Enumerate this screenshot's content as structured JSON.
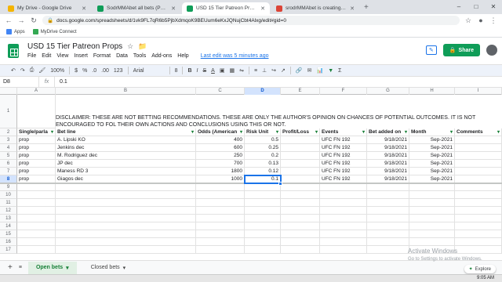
{
  "browser": {
    "tabs": [
      {
        "label": "My Drive - Google Drive",
        "color": "#f4b400",
        "active": false
      },
      {
        "label": "SodrMMAbet all bets (Patreon)",
        "color": "#0f9d58",
        "active": false
      },
      {
        "label": "USD 15 Tier Patreon Props - Goo",
        "color": "#0f9d58",
        "active": true
      },
      {
        "label": "srodrMMAbet is creating Statisti",
        "color": "#db4437",
        "active": false
      }
    ],
    "url": "docs.google.com/spreadsheets/d/1vk9FL7qR6b5PjbXdmqoK9BEUum6eKxJQNujCbt4Alxg/edit#gid=0",
    "bookmarks": [
      {
        "label": "Apps",
        "color": "#4285f4"
      },
      {
        "label": "MyDrive Connect",
        "color": "#4285f4"
      }
    ]
  },
  "doc": {
    "title": "USD 15 Tier Patreon Props",
    "menus": [
      "File",
      "Edit",
      "View",
      "Insert",
      "Format",
      "Data",
      "Tools",
      "Add-ons",
      "Help"
    ],
    "last_edit": "Last edit was 5 minutes ago",
    "share_label": "Share"
  },
  "toolbar": {
    "zoom": "100%",
    "currency": "$",
    "percent": "%",
    "decimals_down": ".0",
    "decimals_up": ".00",
    "format_more": "123",
    "font": "Arial",
    "font_size": "8",
    "bold": "B",
    "italic": "I",
    "strike": "S",
    "text_color": "A"
  },
  "formula_bar": {
    "cell_ref": "D8",
    "fx": "fx",
    "value": "0.1"
  },
  "columns": [
    "A",
    "B",
    "C",
    "D",
    "E",
    "F",
    "G",
    "H",
    "I"
  ],
  "row_numbers": [
    "1",
    "2",
    "3",
    "4",
    "5",
    "6",
    "7",
    "8",
    "9",
    "10",
    "11",
    "12",
    "13",
    "14",
    "15",
    "16",
    "17"
  ],
  "disclaimer": "DISCLAIMER: THESE ARE NOT BETTING RECOMMENDATIONS. THESE ARE ONLY THE AUTHOR'S OPINION ON CHANCES OF POTENTIAL OUTCOMES. IT IS NOT ENCOURAGED TO FOL THEIR OWN ACTIONS AND CONCLUSIONS USING THIS OR NOT.",
  "headers": [
    "Single/parla",
    "Bet line",
    "Odds (American",
    "Risk Unit",
    "Profit/Loss",
    "Events",
    "Bet added on",
    "Month",
    "Comments"
  ],
  "rows": [
    [
      "prop",
      "A. Lipski KO",
      "400",
      "0.5",
      "",
      "UFC FN 192",
      "9/18/2021",
      "Sep-2021",
      ""
    ],
    [
      "prop",
      "Jenkins dec",
      "600",
      "0.25",
      "",
      "UFC FN 192",
      "9/18/2021",
      "Sep-2021",
      ""
    ],
    [
      "prop",
      "M. Rodriguez dec",
      "250",
      "0.2",
      "",
      "UFC FN 192",
      "9/18/2021",
      "Sep-2021",
      ""
    ],
    [
      "prop",
      "JP dec",
      "700",
      "0.13",
      "",
      "UFC FN 192",
      "9/18/2021",
      "Sep-2021",
      ""
    ],
    [
      "prop",
      "Maness RD 3",
      "1800",
      "0.12",
      "",
      "UFC FN 192",
      "9/18/2021",
      "Sep-2021",
      ""
    ],
    [
      "prop",
      "Giagos dec",
      "1000",
      "0.1",
      "",
      "UFC FN 192",
      "9/18/2021",
      "Sep-2021",
      ""
    ]
  ],
  "sheet_tabs": [
    "Open bets",
    "Closed bets"
  ],
  "explore_label": "Explore",
  "activation": {
    "title": "Activate Windows",
    "subtitle": "Go to Settings to activate Windows."
  },
  "clock": "9:05 AM"
}
